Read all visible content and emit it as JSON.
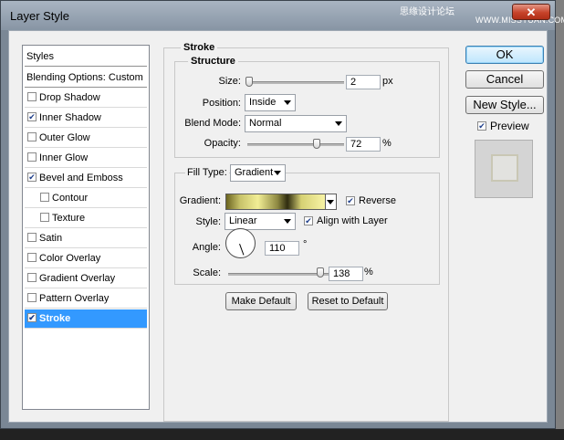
{
  "window": {
    "title": "Layer Style",
    "watermark_top": "思缘设计论坛",
    "watermark_bottom": "WWW.MISSYUAN.COM",
    "close_symbol": "✕"
  },
  "styles_list": {
    "items": [
      {
        "label": "Styles",
        "checkbox": false
      },
      {
        "label": "Blending Options: Custom",
        "checkbox": false
      },
      {
        "label": "Drop Shadow",
        "checkbox": true,
        "checked": false
      },
      {
        "label": "Inner Shadow",
        "checkbox": true,
        "checked": true
      },
      {
        "label": "Outer Glow",
        "checkbox": true,
        "checked": false
      },
      {
        "label": "Inner Glow",
        "checkbox": true,
        "checked": false
      },
      {
        "label": "Bevel and Emboss",
        "checkbox": true,
        "checked": true
      },
      {
        "label": "Contour",
        "checkbox": true,
        "checked": false
      },
      {
        "label": "Texture",
        "checkbox": true,
        "checked": false
      },
      {
        "label": "Satin",
        "checkbox": true,
        "checked": false
      },
      {
        "label": "Color Overlay",
        "checkbox": true,
        "checked": false
      },
      {
        "label": "Gradient Overlay",
        "checkbox": true,
        "checked": false
      },
      {
        "label": "Pattern Overlay",
        "checkbox": true,
        "checked": false
      },
      {
        "label": "Stroke",
        "checkbox": true,
        "checked": true,
        "selected": true
      }
    ]
  },
  "stroke": {
    "section_title": "Stroke",
    "structure": {
      "title": "Structure",
      "size_label": "Size:",
      "size_value": "2",
      "size_unit": "px",
      "size_level": 0.02,
      "position_label": "Position:",
      "position_value": "Inside",
      "blend_mode_label": "Blend Mode:",
      "blend_mode_value": "Normal",
      "opacity_label": "Opacity:",
      "opacity_value": "72",
      "opacity_unit": "%",
      "opacity_level": 0.72
    },
    "fill": {
      "fill_type_label": "Fill Type:",
      "fill_type_value": "Gradient",
      "gradient_label": "Gradient:",
      "reverse_label": "Reverse",
      "reverse_checked": true,
      "style_label": "Style:",
      "style_value": "Linear",
      "align_label": "Align with Layer",
      "align_checked": true,
      "angle_label": "Angle:",
      "angle_value": "110",
      "angle_unit": "°",
      "scale_label": "Scale:",
      "scale_value": "138",
      "scale_unit": "%",
      "scale_level": 0.92
    },
    "make_default_label": "Make Default",
    "reset_default_label": "Reset to Default"
  },
  "right_panel": {
    "ok_label": "OK",
    "cancel_label": "Cancel",
    "new_style_label": "New Style...",
    "preview_label": "Preview",
    "preview_checked": true
  },
  "colors": {
    "selection": "#3399ff",
    "check": "#1d3d8a"
  }
}
